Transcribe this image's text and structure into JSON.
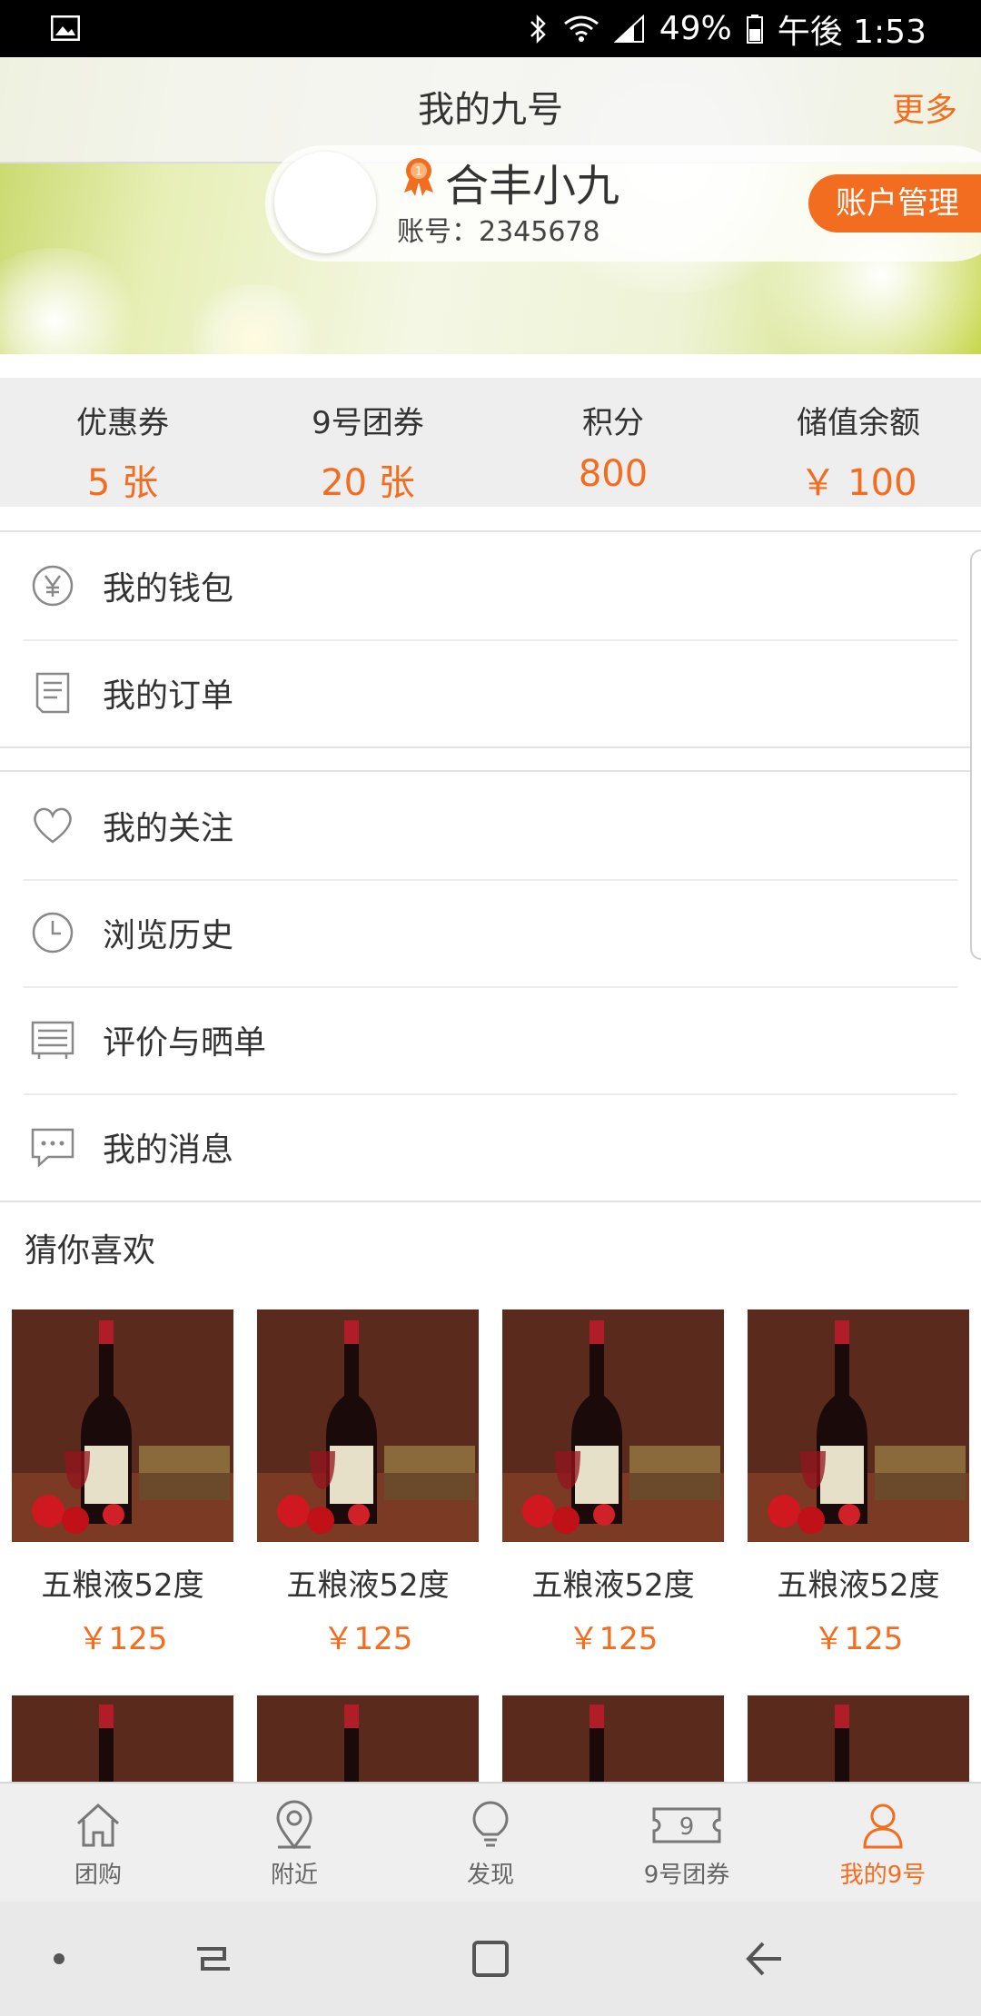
{
  "status_bar": {
    "battery": "49%",
    "time": "午後 1:53"
  },
  "header": {
    "title": "我的九号",
    "more_label": "更多"
  },
  "profile": {
    "username": "合丰小九",
    "account": "账号：2345678",
    "manage_label": "账户管理"
  },
  "stats": [
    {
      "label": "优惠券",
      "value": "5 张"
    },
    {
      "label": "9号团券",
      "value": "20 张"
    },
    {
      "label": "积分",
      "value": "800"
    },
    {
      "label": "储值余额",
      "value": "￥ 100"
    }
  ],
  "menu_group_1": [
    {
      "label": "我的钱包",
      "icon": "yen-circle-icon"
    },
    {
      "label": "我的订单",
      "icon": "order-list-icon"
    }
  ],
  "menu_group_2": [
    {
      "label": "我的关注",
      "icon": "heart-icon"
    },
    {
      "label": "浏览历史",
      "icon": "clock-icon"
    },
    {
      "label": "评价与晒单",
      "icon": "review-icon"
    },
    {
      "label": "我的消息",
      "icon": "message-icon"
    }
  ],
  "recommend": {
    "title": "猜你喜欢",
    "products": [
      {
        "name": "五粮液52度",
        "price": "￥125"
      },
      {
        "name": "五粮液52度",
        "price": "￥125"
      },
      {
        "name": "五粮液52度",
        "price": "￥125"
      },
      {
        "name": "五粮液52度",
        "price": "￥125"
      }
    ]
  },
  "tabbar": [
    {
      "label": "团购",
      "icon": "home-icon",
      "active": false
    },
    {
      "label": "附近",
      "icon": "location-pin-icon",
      "active": false
    },
    {
      "label": "发现",
      "icon": "lightbulb-icon",
      "active": false
    },
    {
      "label": "9号团券",
      "icon": "ticket-icon",
      "active": false
    },
    {
      "label": "我的9号",
      "icon": "user-icon",
      "active": true
    }
  ],
  "colors": {
    "accent": "#f26d1f",
    "text": "#333333",
    "stats_bg": "#eeeeee",
    "tab_bg": "#efefef"
  }
}
